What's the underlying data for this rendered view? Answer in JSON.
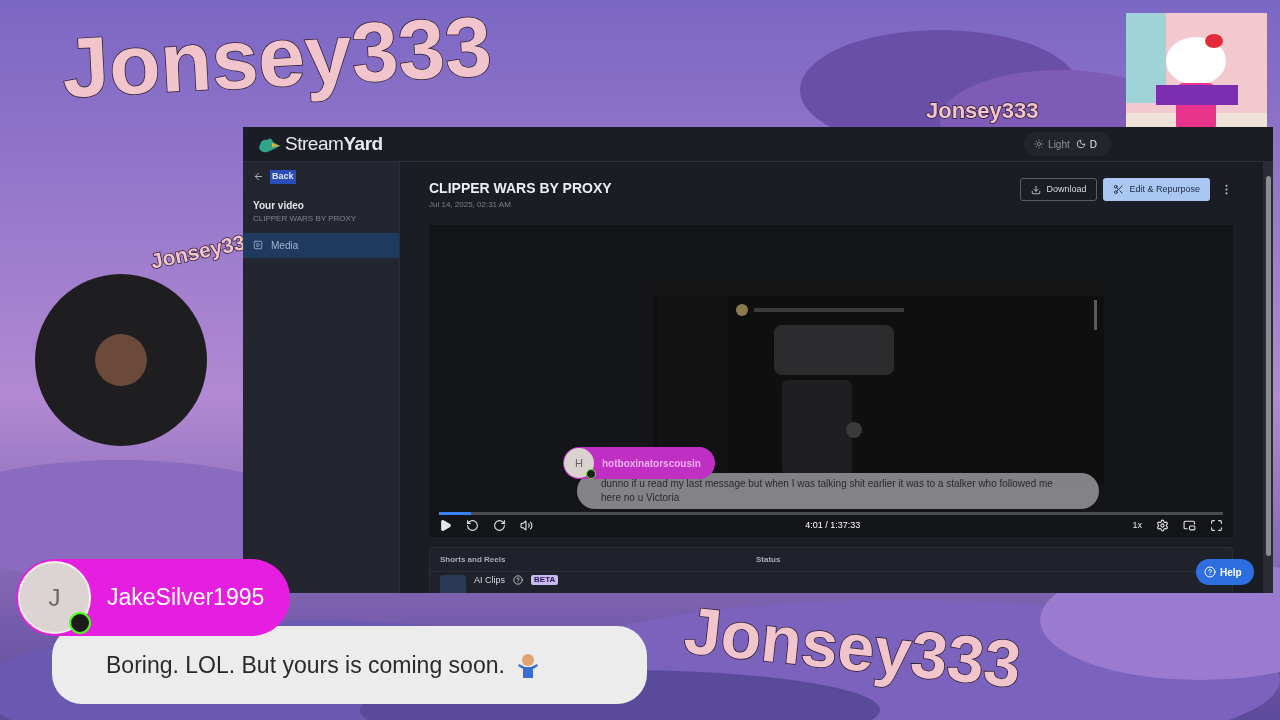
{
  "overlay_texts": [
    {
      "text": "Jonsey333"
    },
    {
      "text": "Jonsey333"
    },
    {
      "text": "Jonsey33"
    },
    {
      "text": "Jonsey333"
    }
  ],
  "streamyard": {
    "brand": "Stream**Yard**",
    "theme_toggle": [
      {
        "label": "Light",
        "selected": false
      },
      {
        "label": "D",
        "selected": true
      }
    ],
    "sidebar": {
      "back": "Back",
      "section_title": "Your video",
      "section_subtitle": "CLIPPER WARS BY PROXY",
      "items": [
        {
          "label": "Media",
          "selected": true
        }
      ]
    },
    "video": {
      "title": "CLIPPER WARS BY PROXY",
      "date": "Jul 14, 2025, 02:31 AM",
      "buttons": [
        {
          "label": "Download",
          "kind": "download"
        },
        {
          "label": "Edit & Repurpose",
          "kind": "edit"
        }
      ]
    },
    "player": {
      "level": 0.041,
      "time": "4:01 / 1:37:33",
      "speed": "1x"
    },
    "video_chat": {
      "initial": "H",
      "username": "hotboxinatorscousin",
      "message": "dunno if u read my last message but when I was talking shit earlier it was to a stalker who followed me here no u Victoria"
    },
    "table": {
      "columns": [
        "Shorts and Reels",
        "Status"
      ],
      "rows": [
        {
          "name": "AI Clips",
          "badge": "BETA"
        }
      ]
    },
    "help": "Help"
  },
  "chat": {
    "initial": "J",
    "username": "JakeSilver1995",
    "message": "Boring. LOL. But yours is coming soon."
  }
}
